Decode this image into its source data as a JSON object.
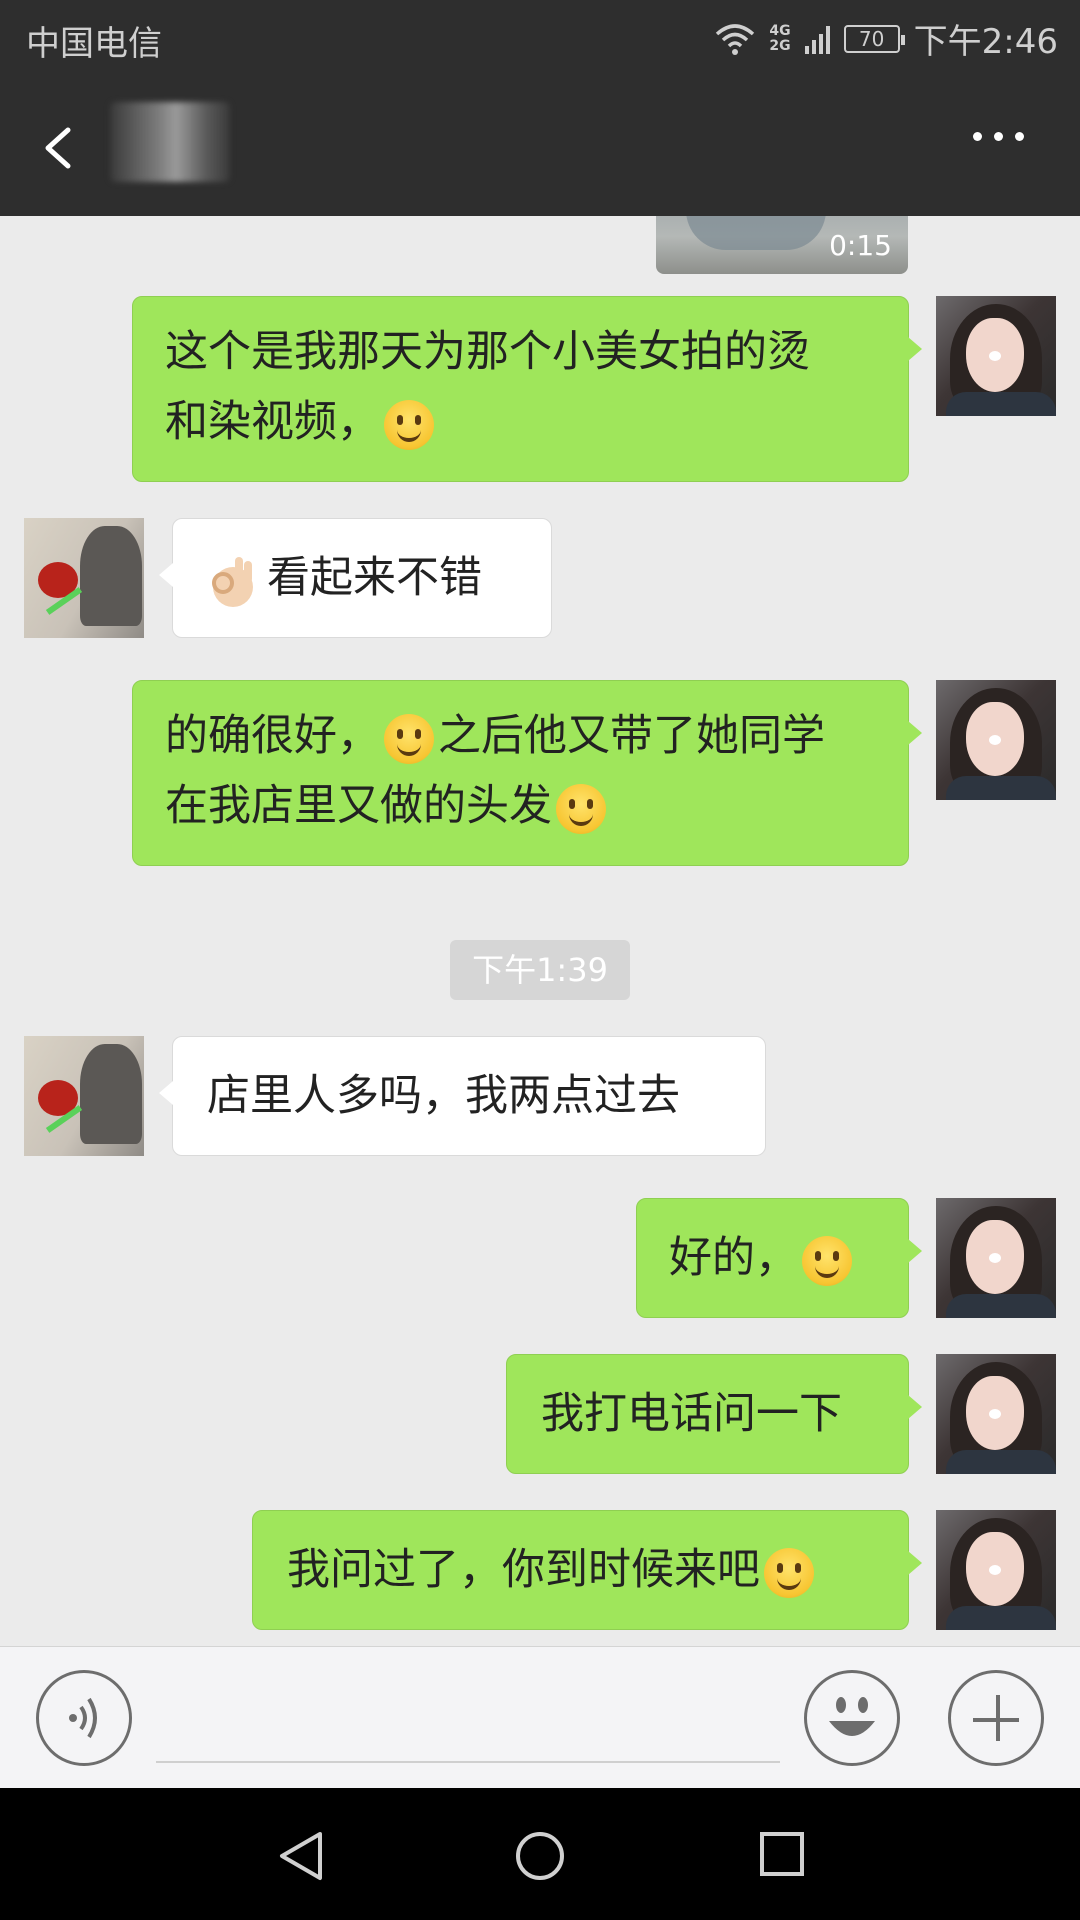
{
  "status_bar": {
    "carrier": "中国电信",
    "network_top": "4G",
    "network_bottom": "2G",
    "battery": "70",
    "time": "下午2:46"
  },
  "title_bar": {
    "back_icon": "back-arrow-icon",
    "more_icon": "more-dots-icon"
  },
  "chat": {
    "video_duration": "0:15",
    "messages": [
      {
        "side": "me",
        "parts": [
          "这个是我那天为那个小美女拍的烫",
          "和染视频，"
        ],
        "emoji": "smile-emoji-icon"
      },
      {
        "side": "other",
        "text": "看起来不错",
        "emoji": "ok-hand-emoji-icon"
      },
      {
        "side": "me",
        "parts": [
          "的确很好，",
          "之后他又带了她同学",
          "在我店里又做的头发"
        ],
        "emoji": "smile-emoji-icon"
      },
      {
        "side": "other",
        "text": "店里人多吗，我两点过去"
      },
      {
        "side": "me",
        "text": "好的，",
        "emoji": "blush-emoji-icon"
      },
      {
        "side": "me",
        "text": "我打电话问一下"
      },
      {
        "side": "me",
        "text": "我问过了，你到时候来吧",
        "emoji": "blush-emoji-icon"
      }
    ],
    "timestamp": "下午1:39"
  },
  "input_bar": {
    "voice_icon": "voice-icon",
    "emoji_icon": "emoji-icon",
    "plus_icon": "plus-icon"
  },
  "nav_bar": {
    "back": "nav-back-icon",
    "home": "nav-home-icon",
    "recent": "nav-recent-icon"
  }
}
